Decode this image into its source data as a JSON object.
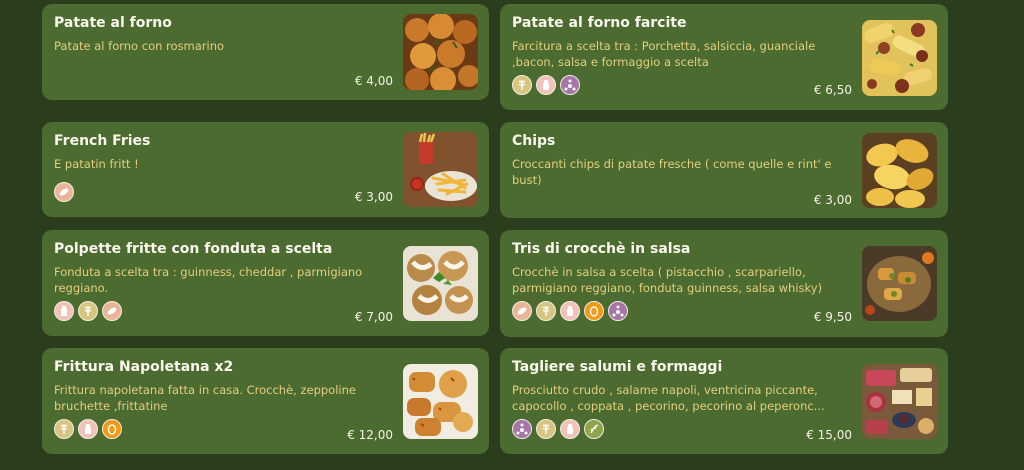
{
  "currency_symbol": "€",
  "items": [
    {
      "title": "Patate al forno",
      "description": "Patate al forno con rosmarino",
      "price": "€ 4,00",
      "allergens": []
    },
    {
      "title": "Patate al forno farcite",
      "description": "Farcitura a scelta tra : Porchetta, salsiccia, guanciale ,bacon, salsa e formaggio a scelta",
      "price": "€ 6,50",
      "allergens": [
        "gluten-icon",
        "milk-icon",
        "molluscs-icon"
      ]
    },
    {
      "title": "French Fries",
      "description": "E patatin fritt !",
      "price": "€ 3,00",
      "allergens": [
        "nuts-icon"
      ]
    },
    {
      "title": "Chips",
      "description": "Croccanti chips di patate fresche ( come quelle e rint' e bust)",
      "price": "€ 3,00",
      "allergens": []
    },
    {
      "title": "Polpette fritte con fonduta a scelta",
      "description": "Fonduta a scelta tra : guinness, cheddar , parmigiano reggiano.",
      "price": "€ 7,00",
      "allergens": [
        "milk-icon",
        "gluten-icon",
        "nuts-icon"
      ]
    },
    {
      "title": "Tris di crocchè in salsa",
      "description": "Crocchè in salsa a scelta ( pistacchio , scarpariello, parmigiano reggiano, fonduta guinness, salsa whisky)",
      "price": "€ 9,50",
      "allergens": [
        "nuts-icon",
        "gluten-icon",
        "milk-icon",
        "egg-icon",
        "molluscs-icon"
      ]
    },
    {
      "title": "Frittura Napoletana x2",
      "description": "Frittura napoletana fatta in casa. Crocchè, zeppoline bruchette ,frittatine",
      "price": "€ 12,00",
      "allergens": [
        "gluten-icon",
        "milk-icon",
        "egg-icon"
      ]
    },
    {
      "title": "Tagliere salumi e formaggi",
      "description": "Prosciutto crudo , salame napoli, ventricina piccante, capocollo , coppata , pecorino, pecorino al peperonc...",
      "price": "€ 15,00",
      "allergens": [
        "molluscs-icon",
        "gluten-icon",
        "milk-icon",
        "celery-icon"
      ]
    }
  ],
  "colors": {
    "background": "#2b3d1d",
    "card": "#4b6b30",
    "title": "#fbf8ee",
    "description": "#e4cf7d"
  }
}
